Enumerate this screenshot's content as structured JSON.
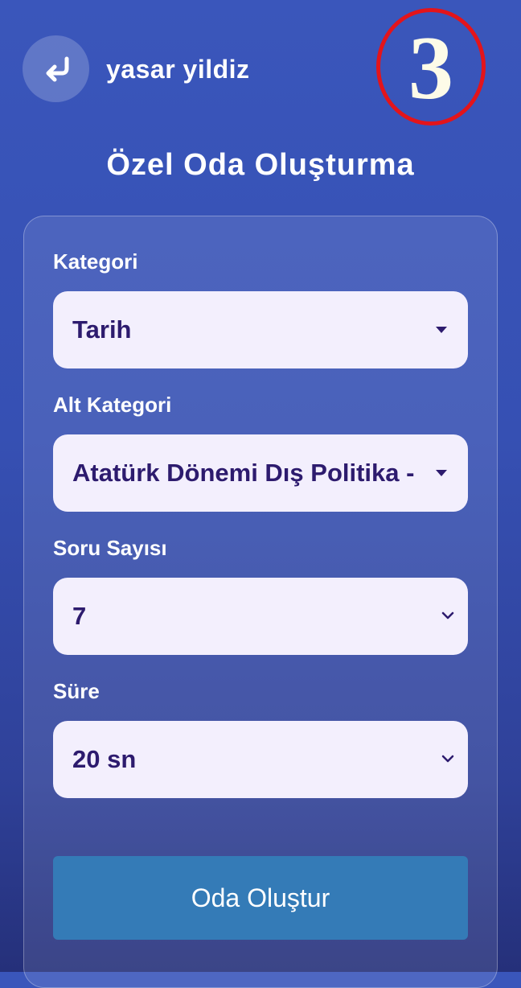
{
  "header": {
    "username": "yasar yildiz",
    "counter": "3"
  },
  "page": {
    "title": "Özel Oda Oluşturma"
  },
  "form": {
    "category": {
      "label": "Kategori",
      "value": "Tarih",
      "icon": "caret-down-icon"
    },
    "subcategory": {
      "label": "Alt Kategori",
      "value": "Atatürk Dönemi Dış Politika -",
      "icon": "caret-down-icon"
    },
    "question_count": {
      "label": "Soru Sayısı",
      "value": "7",
      "icon": "chevron-down-icon"
    },
    "duration": {
      "label": "Süre",
      "value": "20 sn",
      "icon": "chevron-down-icon"
    },
    "submit_label": "Oda Oluştur"
  },
  "colors": {
    "background": "#3650b3",
    "select_bg": "#f3effd",
    "select_text": "#2d1b6e",
    "button": "#347bb7",
    "counter_ring": "#e3141b"
  }
}
